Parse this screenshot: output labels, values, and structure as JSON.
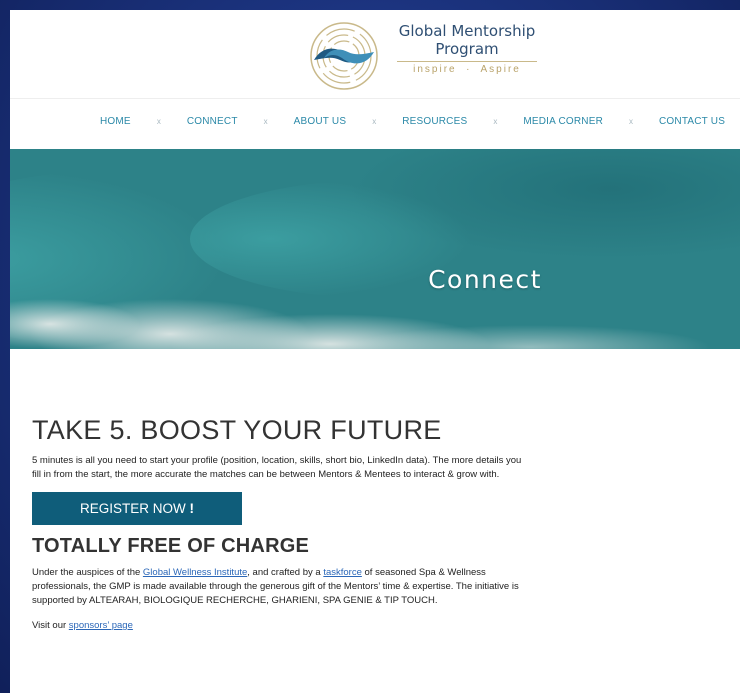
{
  "logo": {
    "line1": "Global Mentorship",
    "line2": "Program",
    "tagline_left": "inspire",
    "tagline_right": "Aspire",
    "icon": "hands-labyrinth-icon"
  },
  "nav": {
    "items": [
      {
        "label": "HOME"
      },
      {
        "label": "CONNECT"
      },
      {
        "label": "ABOUT US"
      },
      {
        "label": "RESOURCES"
      },
      {
        "label": "MEDIA CORNER"
      },
      {
        "label": "CONTACT US"
      }
    ],
    "separator": "x"
  },
  "hero": {
    "title": "Connect"
  },
  "intro": {
    "heading": "TAKE 5. BOOST YOUR FUTURE",
    "text": "5 minutes is all you need to start your profile (position, location, skills, short bio, LinkedIn data). The more details you fill in from the start, the more accurate the matches can be between Mentors & Mentees to interact & grow with."
  },
  "register": {
    "label": "REGISTER NOW",
    "bang": "!"
  },
  "free": {
    "heading": "TOTALLY FREE OF CHARGE",
    "text_1": "Under the auspices of the ",
    "link_gwi": "Global Wellness Institute",
    "text_2": ", and crafted by a ",
    "link_taskforce": "taskforce",
    "text_3": " of seasoned Spa & Wellness professionals, the GMP is made available through the generous gift of the Mentors’ time & expertise. The initiative is supported by ALTEARAH, BIOLOGIQUE RECHERCHE, GHARIENI, SPA GENIE & TIP TOUCH."
  },
  "sponsors": {
    "text": "Visit our ",
    "link": "sponsors’ page"
  },
  "colors": {
    "nav_text": "#2b89a8",
    "button_bg": "#0f5d7a",
    "link": "#2b67b8",
    "page_bg": "#1c3480"
  }
}
